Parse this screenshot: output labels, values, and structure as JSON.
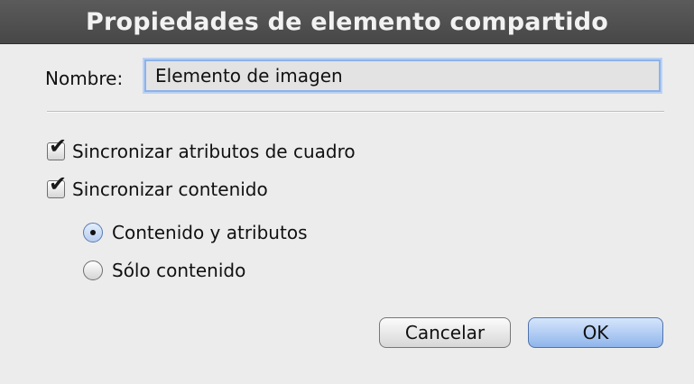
{
  "dialog": {
    "title": "Propiedades de elemento compartido"
  },
  "name_field": {
    "label": "Nombre:",
    "value": "Elemento de imagen"
  },
  "checkboxes": [
    {
      "label": "Sincronizar atributos de cuadro",
      "checked": true
    },
    {
      "label": "Sincronizar contenido",
      "checked": true
    }
  ],
  "radios": [
    {
      "label": "Contenido y atributos",
      "selected": true
    },
    {
      "label": "Sólo contenido",
      "selected": false
    }
  ],
  "buttons": {
    "cancel": "Cancelar",
    "ok": "OK"
  },
  "colors": {
    "titlebar": "#4f4f4f",
    "background": "#ececec",
    "focus_ring": "#8db2e8",
    "default_button": "#8fb5ec"
  },
  "icons": {
    "check": "checkmark-icon",
    "radio_dot": "radio-dot-icon"
  }
}
